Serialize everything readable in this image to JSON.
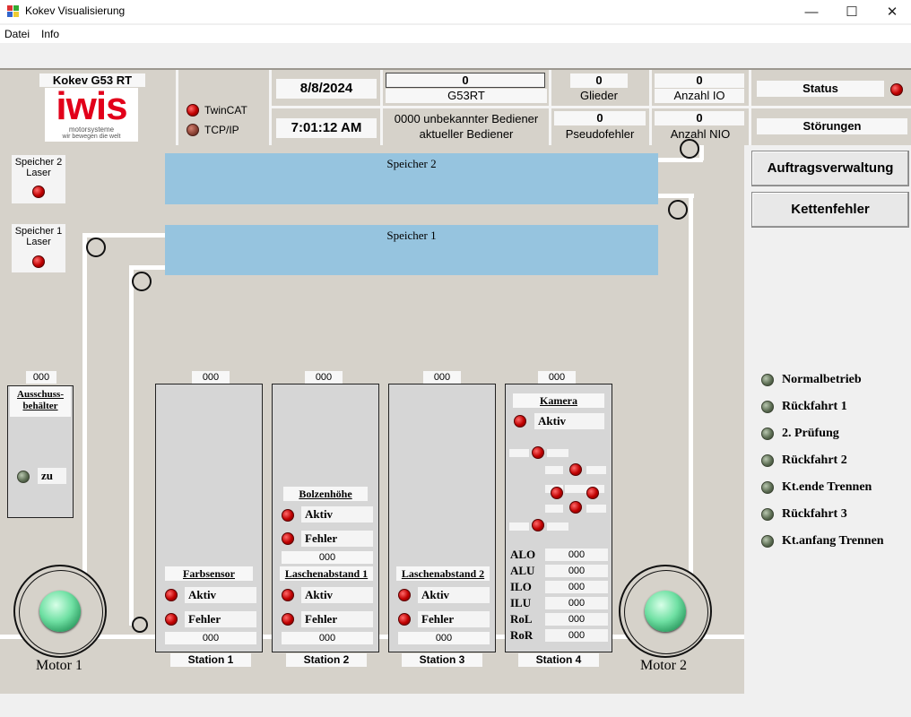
{
  "window": {
    "title": "Kokev Visualisierung",
    "minimize": "—",
    "maximize": "☐",
    "close": "✕"
  },
  "menu": [
    "Datei",
    "Info"
  ],
  "header": {
    "machine": "Kokev G53 RT",
    "logo_main": "iwis",
    "logo_sub1": "motorsysteme",
    "logo_sub2": "wir bewegen die welt",
    "twincat": "TwinCAT",
    "tcpip": "TCP/IP",
    "date": "8/8/2024",
    "time": "7:01:12 AM",
    "g53rt_value": "0",
    "g53rt_label": "G53RT",
    "operator_line1": "0000 unbekannter Bediener",
    "operator_line2": "aktueller Bediener",
    "glieder_value": "0",
    "glieder_label": "Glieder",
    "anzahl_io_value": "0",
    "anzahl_io_label": "Anzahl IO",
    "pseudo_value": "0",
    "pseudo_label": "Pseudofehler",
    "anzahl_nio_value": "0",
    "anzahl_nio_label": "Anzahl NIO",
    "status_label": "Status",
    "stoerungen_label": "Störungen"
  },
  "storage": {
    "speicher2": "Speicher 2",
    "speicher1": "Speicher 1",
    "laser2_l1": "Speicher 2",
    "laser2_l2": "Laser",
    "laser1_l1": "Speicher 1",
    "laser1_l2": "Laser"
  },
  "ausschuss": {
    "count": "000",
    "title1": "Ausschuss-",
    "title2": "behälter",
    "state": "zu"
  },
  "stations": {
    "s1": {
      "count": "000",
      "sensor": "Farbsensor",
      "aktiv": "Aktiv",
      "fehler": "Fehler",
      "bottom": "000",
      "label": "Station 1"
    },
    "s2": {
      "count": "000",
      "sensor_top": "Bolzenhöhe",
      "top_aktiv": "Aktiv",
      "top_fehler": "Fehler",
      "top_count": "000",
      "sensor": "Laschenabstand 1",
      "aktiv": "Aktiv",
      "fehler": "Fehler",
      "bottom": "000",
      "label": "Station 2"
    },
    "s3": {
      "count": "000",
      "sensor": "Laschenabstand 2",
      "aktiv": "Aktiv",
      "fehler": "Fehler",
      "bottom": "000",
      "label": "Station 3"
    },
    "s4": {
      "count": "000",
      "sensor": "Kamera",
      "aktiv": "Aktiv",
      "label": "Station 4",
      "rows": [
        {
          "name": "ALO",
          "value": "000"
        },
        {
          "name": "ALU",
          "value": "000"
        },
        {
          "name": "ILO",
          "value": "000"
        },
        {
          "name": "ILU",
          "value": "000"
        },
        {
          "name": "RoL",
          "value": "000"
        },
        {
          "name": "RoR",
          "value": "000"
        }
      ]
    }
  },
  "motors": {
    "m1": "Motor 1",
    "m2": "Motor 2"
  },
  "right": {
    "auftrag": "Auftragsverwaltung",
    "kette": "Kettenfehler",
    "modes": [
      "Normalbetrieb",
      "Rückfahrt 1",
      "2. Prüfung",
      "Rückfahrt 2",
      "Kt.ende Trennen",
      "Rückfahrt 3",
      "Kt.anfang Trennen"
    ]
  },
  "colors": {
    "panel": "#d6d2ca",
    "storage": "#96c4df",
    "led_red": "#c00000",
    "motor_green": "#6fe0a3"
  }
}
